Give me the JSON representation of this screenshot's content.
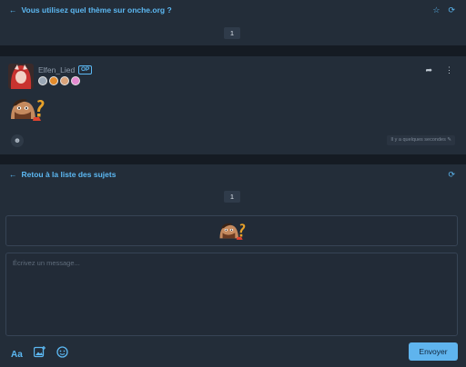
{
  "topic": {
    "title": "Vous utilisez quel thème sur onche.org ?",
    "page": "1"
  },
  "post": {
    "username": "Elfen_Lied",
    "op_badge": "OP",
    "timestamp": "Il y a quelques secondes",
    "badges": [
      {
        "name": "shield-badge",
        "color": "#9aa7b5"
      },
      {
        "name": "lion-badge",
        "color": "#e38b2c"
      },
      {
        "name": "character-badge",
        "color": "#d9a37a"
      },
      {
        "name": "flower-badge",
        "color": "#e48ad0"
      }
    ]
  },
  "list_nav": {
    "back_label": "Retou à la liste des sujets",
    "page": "1"
  },
  "composer": {
    "placeholder": "Écrivez un message...",
    "format_label": "Aa",
    "submit_label": "Envoyer"
  },
  "colors": {
    "accent": "#5cb8f2",
    "panel": "#232d39",
    "background": "#151b23",
    "button": "#5fb4ee"
  }
}
